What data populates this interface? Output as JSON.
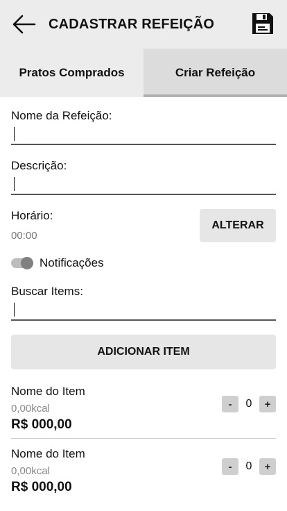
{
  "appbar": {
    "title": "CADASTRAR REFEIÇÃO",
    "back_icon": "arrow-left-icon",
    "save_icon": "floppy-disk-icon"
  },
  "tabs": [
    {
      "label": "Pratos Comprados",
      "active": false
    },
    {
      "label": "Criar Refeição",
      "active": true
    }
  ],
  "form": {
    "meal_name_label": "Nome da Refeição:",
    "meal_name_value": "",
    "description_label": "Descrição:",
    "description_value": "",
    "time_label": "Horário:",
    "time_value": "00:00",
    "change_button": "ALTERAR",
    "notifications_label": "Notificações",
    "notifications_on": true,
    "search_label": "Buscar Items:",
    "search_value": "",
    "add_item_button": "ADICIONAR ITEM"
  },
  "items": [
    {
      "name": "Nome do Item",
      "kcal": "0,00kcal",
      "price": "R$ 000,00",
      "qty": "0",
      "minus": "-",
      "plus": "+"
    },
    {
      "name": "Nome do Item",
      "kcal": "0,00kcal",
      "price": "R$ 000,00",
      "qty": "0",
      "minus": "-",
      "plus": "+"
    }
  ],
  "colors": {
    "appbar_bg": "#ececec",
    "active_tab_bg": "#dcdcdc",
    "button_bg": "#e6e6e6"
  }
}
